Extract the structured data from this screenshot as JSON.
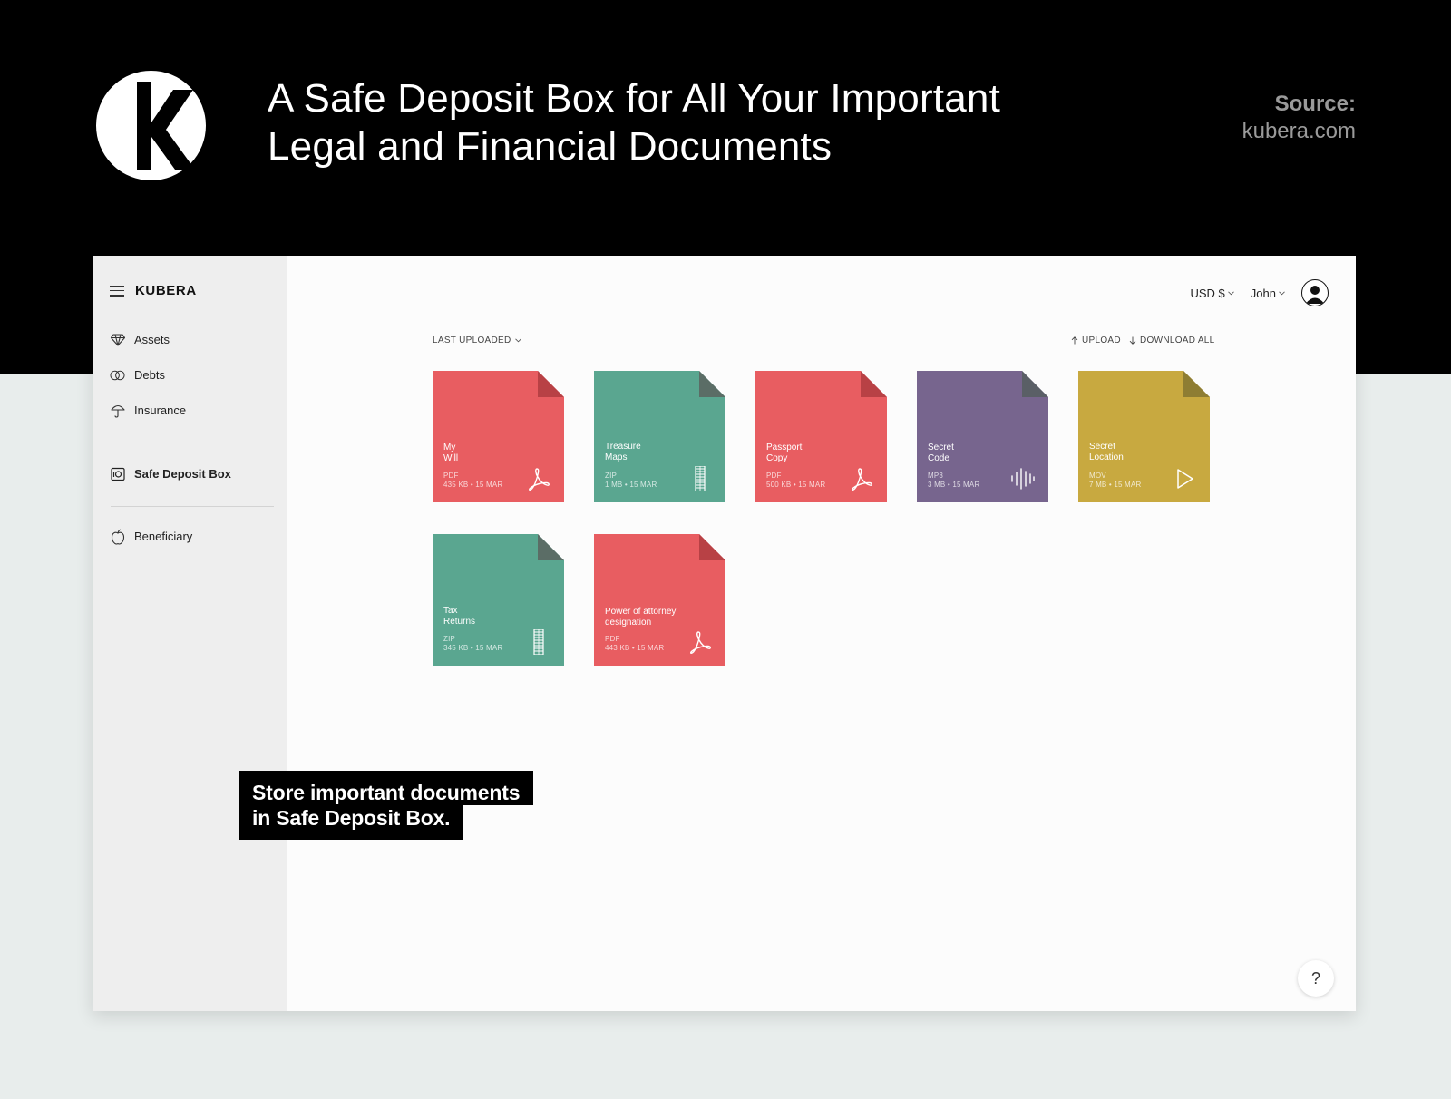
{
  "banner": {
    "headline_line1": "A Safe Deposit Box for All Your Important",
    "headline_line2": "Legal and Financial Documents",
    "source_label": "Source:",
    "source_url": "kubera.com",
    "logo_letter": "K"
  },
  "app": {
    "brand": "KUBERA",
    "nav": [
      {
        "label": "Assets",
        "icon": "diamond-icon"
      },
      {
        "label": "Debts",
        "icon": "rings-icon"
      },
      {
        "label": "Insurance",
        "icon": "umbrella-icon"
      },
      {
        "label": "Safe Deposit Box",
        "icon": "safe-icon",
        "active": true
      },
      {
        "label": "Beneficiary",
        "icon": "apple-icon"
      }
    ],
    "currency": "USD $",
    "user": "John",
    "sort_label": "LAST UPLOADED",
    "upload_label": "UPLOAD",
    "download_label": "DOWNLOAD ALL",
    "help": "?",
    "files": [
      {
        "name_l1": "My",
        "name_l2": "Will",
        "type": "PDF",
        "meta": "435 KB • 15 MAR",
        "color": "#e85d61",
        "fold": "#b84145",
        "icon": "pdf-icon"
      },
      {
        "name_l1": "Treasure",
        "name_l2": "Maps",
        "type": "ZIP",
        "meta": "1 MB • 15 MAR",
        "color": "#5aa690",
        "fold": "#5b6d66",
        "icon": "zip-icon"
      },
      {
        "name_l1": "Passport",
        "name_l2": "Copy",
        "type": "PDF",
        "meta": "500 KB • 15 MAR",
        "color": "#e85d61",
        "fold": "#b84145",
        "icon": "pdf-icon"
      },
      {
        "name_l1": "Secret",
        "name_l2": "Code",
        "type": "MP3",
        "meta": "3 MB • 15 MAR",
        "color": "#77658e",
        "fold": "#5a5f66",
        "icon": "audio-icon"
      },
      {
        "name_l1": "Secret",
        "name_l2": "Location",
        "type": "MOV",
        "meta": "7 MB • 15 MAR",
        "color": "#c8a940",
        "fold": "#8e7d33",
        "icon": "video-icon"
      },
      {
        "name_l1": "Tax",
        "name_l2": "Returns",
        "type": "ZIP",
        "meta": "345 KB • 15 MAR",
        "color": "#5aa690",
        "fold": "#5b6d66",
        "icon": "zip-icon"
      },
      {
        "name_l1": "Power of attorney",
        "name_l2": "designation",
        "type": "PDF",
        "meta": "443 KB • 15 MAR",
        "color": "#e85d61",
        "fold": "#b84145",
        "icon": "pdf-icon"
      }
    ]
  },
  "callout": {
    "line1": "Store important documents",
    "line2": "in Safe Deposit Box."
  }
}
